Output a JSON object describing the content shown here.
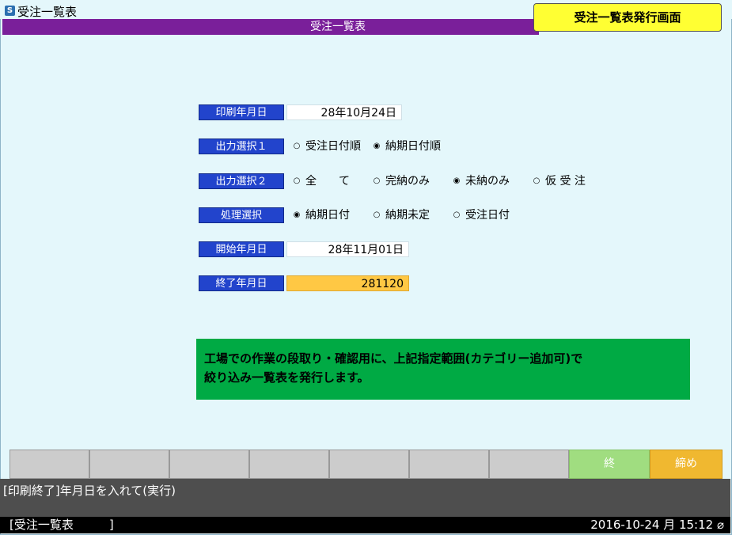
{
  "window": {
    "icon_glyph": "S",
    "title": "受注一覧表"
  },
  "header": {
    "banner_title": "受注一覧表",
    "screen_badge": "受注一覧表発行画面"
  },
  "form": {
    "print_date": {
      "label": "印刷年月日",
      "value": "28年10月24日"
    },
    "output1": {
      "label": "出力選択１",
      "options": [
        "受注日付順",
        "納期日付順"
      ],
      "selected": 1
    },
    "output2": {
      "label": "出力選択２",
      "options": [
        "全　　て",
        "完納のみ",
        "未納のみ",
        "仮 受 注"
      ],
      "selected": 2
    },
    "process": {
      "label": "処理選択",
      "options": [
        "納期日付",
        "納期未定",
        "受注日付"
      ],
      "selected": 0
    },
    "start_date": {
      "label": "開始年月日",
      "value": "28年11月01日"
    },
    "end_date": {
      "label": "終了年月日",
      "value": "281120"
    }
  },
  "info": {
    "line1": "工場での作業の段取り・確認用に、上記指定範囲(カテゴリー追加可)で",
    "line2": "絞り込み一覧表を発行します。"
  },
  "function_keys": [
    "",
    "",
    "",
    "",
    "",
    "",
    "",
    "終",
    "締め"
  ],
  "colors": {
    "purple": "#7a1f9a",
    "label_blue": "#2244cc",
    "info_green": "#00aa44",
    "badge_yellow": "#ffff33",
    "end_orange": "#ffc844"
  },
  "message": "[印刷終了]年月日を入れて(実行)",
  "status": {
    "left": "[受注一覧表　　　]",
    "right": "2016-10-24 月 15:12 ⌀"
  }
}
